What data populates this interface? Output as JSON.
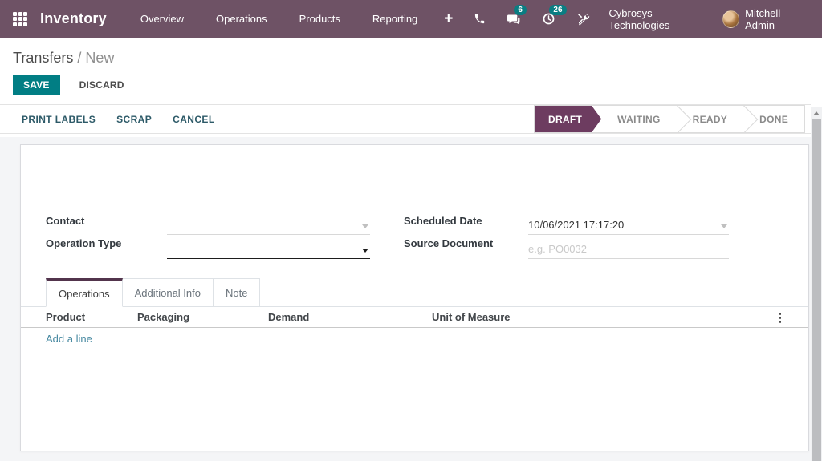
{
  "topbar": {
    "app_name": "Inventory",
    "menu": [
      {
        "label": "Overview"
      },
      {
        "label": "Operations"
      },
      {
        "label": "Products"
      },
      {
        "label": "Reporting"
      }
    ],
    "plus_glyph": "+",
    "messages_badge": "6",
    "activities_badge": "26",
    "company": "Cybrosys Technologies",
    "user_name": "Mitchell Admin"
  },
  "breadcrumb": {
    "parent": "Transfers",
    "separator": " / ",
    "current": "New"
  },
  "actions": {
    "save": "SAVE",
    "discard": "DISCARD"
  },
  "toolbar": {
    "buttons": [
      {
        "label": "PRINT LABELS"
      },
      {
        "label": "SCRAP"
      },
      {
        "label": "CANCEL"
      }
    ]
  },
  "statusbar": {
    "steps": [
      {
        "label": "DRAFT",
        "active": true
      },
      {
        "label": "WAITING",
        "active": false
      },
      {
        "label": "READY",
        "active": false
      },
      {
        "label": "DONE",
        "active": false
      }
    ]
  },
  "form": {
    "contact": {
      "label": "Contact",
      "value": ""
    },
    "operation_type": {
      "label": "Operation Type",
      "value": ""
    },
    "scheduled_date": {
      "label": "Scheduled Date",
      "value": "10/06/2021 17:17:20"
    },
    "source_document": {
      "label": "Source Document",
      "value": "",
      "placeholder": "e.g. PO0032"
    }
  },
  "tabs": [
    {
      "label": "Operations",
      "active": true
    },
    {
      "label": "Additional Info",
      "active": false
    },
    {
      "label": "Note",
      "active": false
    }
  ],
  "lines_table": {
    "columns": [
      "Product",
      "Packaging",
      "Demand",
      "Unit of Measure"
    ],
    "kebab_glyph": "⋮",
    "add_line_label": "Add a line",
    "rows": []
  },
  "colors": {
    "header_bg": "#6e5265",
    "accent_teal": "#017e84",
    "status_active": "#6d3c60",
    "badge": "#0a7d82",
    "link": "#4688a0"
  }
}
